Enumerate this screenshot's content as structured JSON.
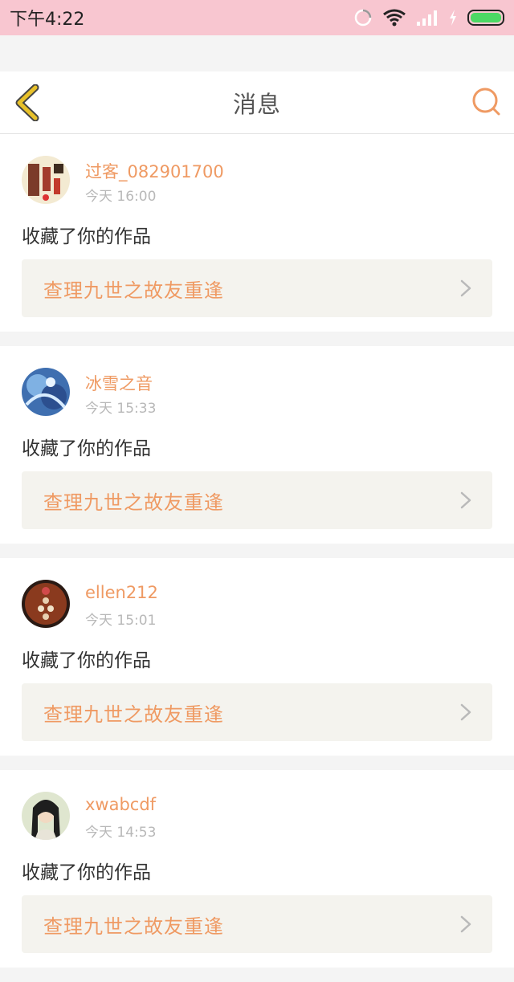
{
  "status": {
    "time": "下午4:22",
    "icons": [
      "sync-icon",
      "wifi-icon",
      "signal-icon",
      "charging-icon",
      "battery-icon"
    ]
  },
  "header": {
    "title": "消息",
    "back_icon": "chevron-left-icon",
    "search_icon": "search-icon"
  },
  "colors": {
    "accent": "#ef9a63",
    "statusbar": "#f8c6d0",
    "back_yellow": "#e8c12a",
    "card_bg": "#f4f3ee"
  },
  "messages": [
    {
      "user": "过客_082901700",
      "time": "今天 16:00",
      "action": "收藏了你的作品",
      "work_title": "查理九世之故友重逢"
    },
    {
      "user": "冰雪之音",
      "time": "今天 15:33",
      "action": "收藏了你的作品",
      "work_title": "查理九世之故友重逢"
    },
    {
      "user": "ellen212",
      "time": "今天 15:01",
      "action": "收藏了你的作品",
      "work_title": "查理九世之故友重逢"
    },
    {
      "user": "xwabcdf",
      "time": "今天 14:53",
      "action": "收藏了你的作品",
      "work_title": "查理九世之故友重逢"
    }
  ]
}
